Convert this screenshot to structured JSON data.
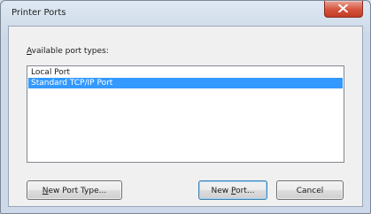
{
  "window": {
    "title": "Printer Ports"
  },
  "close_button": {
    "icon": "close-icon",
    "color": "#c8452f"
  },
  "ports": {
    "label_accel": "A",
    "label_rest": "vailable port types:",
    "items": [
      {
        "label": "Local Port",
        "selected": false
      },
      {
        "label": "Standard TCP/IP Port",
        "selected": true
      }
    ],
    "selection_color": "#3399ff"
  },
  "buttons": {
    "new_port_type": {
      "pre": "",
      "accel": "N",
      "post": "ew Port Type..."
    },
    "new_port": {
      "pre": "New ",
      "accel": "P",
      "post": "ort..."
    },
    "cancel": {
      "label": "Cancel"
    }
  }
}
